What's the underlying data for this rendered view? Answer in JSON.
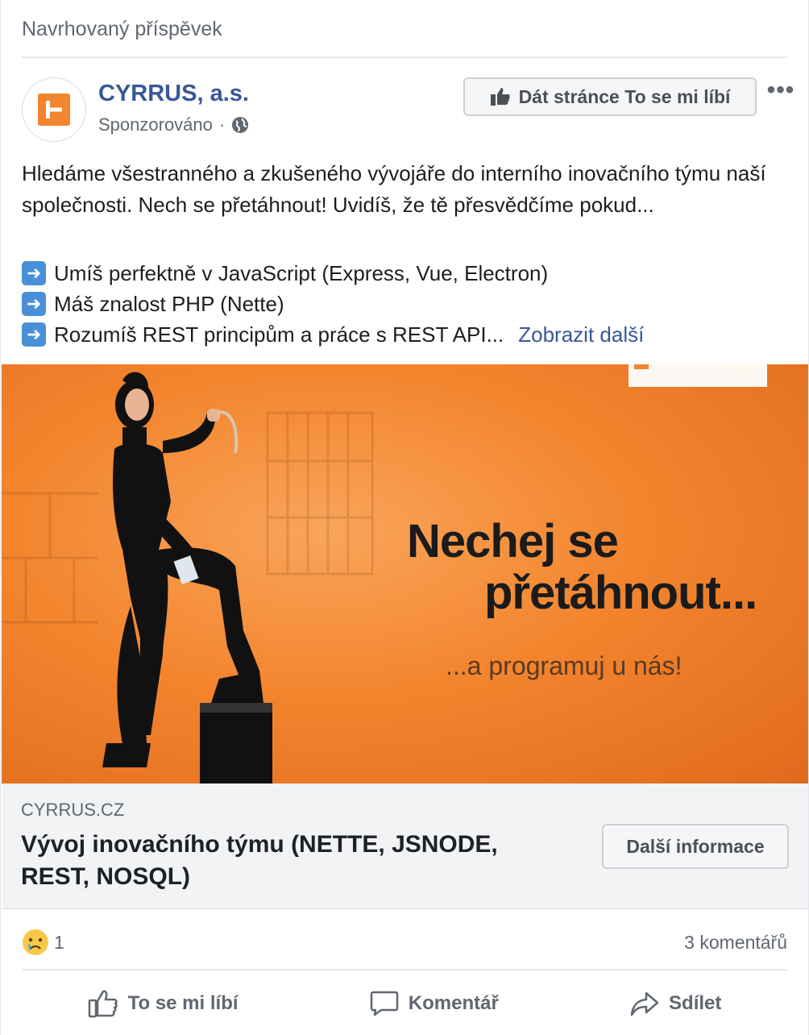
{
  "header": {
    "suggested_label": "Navrhovaný příspěvek"
  },
  "page": {
    "name": "CYRRUS, a.s.",
    "sponsored": "Sponzorováno",
    "like_page_label": "Dát stránce To se mi líbí",
    "more_label": "•••"
  },
  "post": {
    "text": "Hledáme všestranného a zkušeného vývojáře do interního inovačního týmu naší společnosti. Nech se přetáhnout! Uvidíš, že tě přesvědčíme pokud...",
    "bullets": [
      "Umíš perfektně v JavaScript (Express, Vue, Electron)",
      "Máš znalost PHP (Nette)",
      "Rozumíš REST principům a práce s REST API..."
    ],
    "see_more": "Zobrazit další"
  },
  "ad_image": {
    "headline_line1": "Nechej se",
    "headline_line2": "přetáhnout...",
    "subline": "...a programuj u nás!"
  },
  "link": {
    "domain": "CYRRUS.CZ",
    "title": "Vývoj inovačního týmu (NETTE, JSNODE, REST, NOSQL)",
    "cta_label": "Další informace"
  },
  "stats": {
    "reaction_count": "1",
    "comments": "3 komentářů"
  },
  "actions": {
    "like": "To se mi líbí",
    "comment": "Komentář",
    "share": "Sdílet"
  },
  "colors": {
    "link_blue": "#385898",
    "brand_orange": "#f3852e",
    "muted_text": "#606770"
  }
}
